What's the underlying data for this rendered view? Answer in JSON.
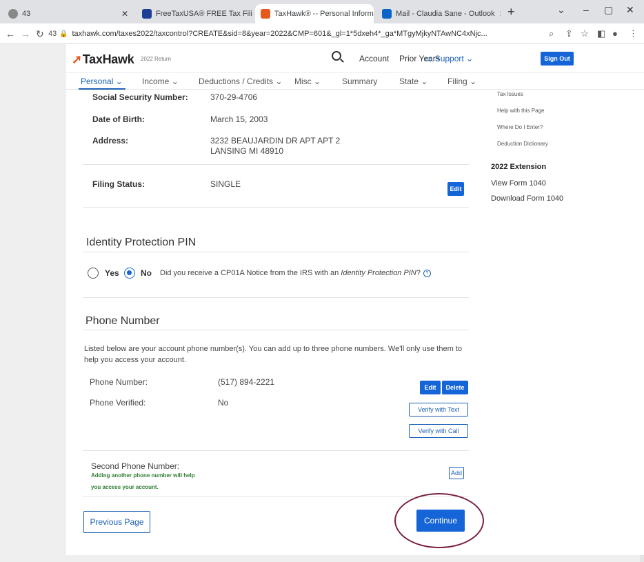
{
  "browser": {
    "tabs": [
      {
        "label": "43",
        "icon": "globe-icon"
      },
      {
        "label": "FreeTaxUSA® FREE Tax Filing",
        "icon": "freetaxusa-favicon"
      },
      {
        "label": "TaxHawk® -- Personal Inform",
        "icon": "taxhawk-favicon"
      },
      {
        "label": "Mail - Claudia Sane - Outlook",
        "icon": "outlook-favicon"
      }
    ],
    "new_tab": "+",
    "address_prefix": "43",
    "url": "taxhawk.com/taxes2022/taxcontrol?CREATE&sid=8&year=2022&CMP=601&_gl=1*5dxeh4*_ga*MTgyMjkyNTAwNC4xNjc..."
  },
  "header": {
    "logo": "TaxHawk",
    "tax_year": "2022 Return",
    "links": [
      "Account",
      "Prior Years"
    ],
    "support": "Support",
    "sign_out": "Sign Out"
  },
  "subnav": {
    "items": [
      "Personal",
      "Income",
      "Deductions / Credits",
      "Misc",
      "Summary",
      "State",
      "Filing"
    ]
  },
  "personal": {
    "ssn_label": "Social Security Number:",
    "ssn_value": "370-29-4706",
    "dob_label": "Date of Birth:",
    "dob_value": "March 15, 2003",
    "address_label": "Address:",
    "address_line1": "3232 BEAUJARDIN DR APT APT 2",
    "address_line2": "LANSING MI 48910",
    "filing_label": "Filing Status:",
    "filing_value": "SINGLE",
    "edit_label": "Edit"
  },
  "ip_pin": {
    "title": "Identity Protection PIN",
    "yes": "Yes",
    "no": "No",
    "selected": "No",
    "question_a": "Did you receive a CP01A Notice from the IRS with an ",
    "question_b": "Identity Protection PIN",
    "question_c": "?"
  },
  "phone": {
    "title": "Phone Number",
    "description": "Listed below are your account phone number(s). You can add up to three phone numbers. We'll only use them to help you access your account.",
    "number_label": "Phone Number:",
    "number_value": "(517) 894-2221",
    "verified_label": "Phone Verified:",
    "verified_value": "No",
    "edit": "Edit",
    "delete": "Delete",
    "verify_text": "Verify with Text",
    "verify_call": "Verify with Call",
    "second_label": "Second Phone Number:",
    "second_hint_1": "Adding another phone number will help",
    "second_hint_2": "you access your account.",
    "add": "Add"
  },
  "footer": {
    "previous": "Previous Page",
    "continue": "Continue"
  },
  "sidebar": {
    "small_links": [
      "Tax Issues",
      "Help with this Page",
      "Where Do I Enter?",
      "Deduction Dictionary"
    ],
    "extension_head": "2022 Extension",
    "links": [
      "View Form 1040",
      "Download Form 1040"
    ]
  },
  "colors": {
    "accent": "#1565d8",
    "hint_green": "#2e7d32",
    "annotation_circle": "#7a1f3d"
  }
}
